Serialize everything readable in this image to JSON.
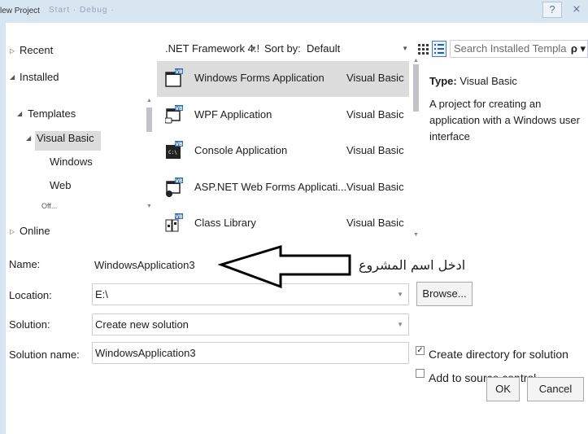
{
  "window": {
    "title": "lew Project",
    "toolbar_ghost": "Start · Debug · ",
    "help_glyph": "?",
    "close_glyph": "⨯"
  },
  "nav": {
    "recent": "Recent",
    "installed": "Installed",
    "templates": "Templates",
    "visual_basic": "Visual Basic",
    "windows": "Windows",
    "web": "Web",
    "office_partial": "Off...",
    "online": "Online"
  },
  "toolbar": {
    "framework": ".NET Framework 4.!",
    "sort_label": "Sort by:",
    "sort_value": "Default",
    "search_placeholder": "Search Installed Templa"
  },
  "templates": [
    {
      "name": "Windows Forms Application",
      "lang": "Visual Basic",
      "selected": true
    },
    {
      "name": "WPF Application",
      "lang": "Visual Basic",
      "selected": false
    },
    {
      "name": "Console Application",
      "lang": "Visual Basic",
      "selected": false
    },
    {
      "name": "ASP.NET Web Forms Applicati...",
      "lang": "Visual Basic",
      "selected": false
    },
    {
      "name": "Class Library",
      "lang": "Visual Basic",
      "selected": false
    }
  ],
  "description": {
    "type_label": "Type:",
    "type_value": "Visual Basic",
    "text": "A project for creating an application with a Windows user interface"
  },
  "form": {
    "name_label": "Name:",
    "name_value": "WindowsApplication3",
    "location_label": "Location:",
    "location_value": "E:\\",
    "browse": "Browse...",
    "solution_label": "Solution:",
    "solution_value": "Create new solution",
    "solution_name_label": "Solution name:",
    "solution_name_value": "WindowsApplication3",
    "create_directory": "Create directory for solution",
    "create_directory_checked": true,
    "add_source_control": "Add to source control",
    "add_source_control_checked": false,
    "ok": "OK",
    "cancel": "Cancel"
  },
  "annotation": {
    "text": "ادخل اسم المشروع"
  },
  "colors": {
    "selection": "#dcdcdc",
    "border": "#cccedb",
    "vb_icon": "#2b6cb5"
  }
}
